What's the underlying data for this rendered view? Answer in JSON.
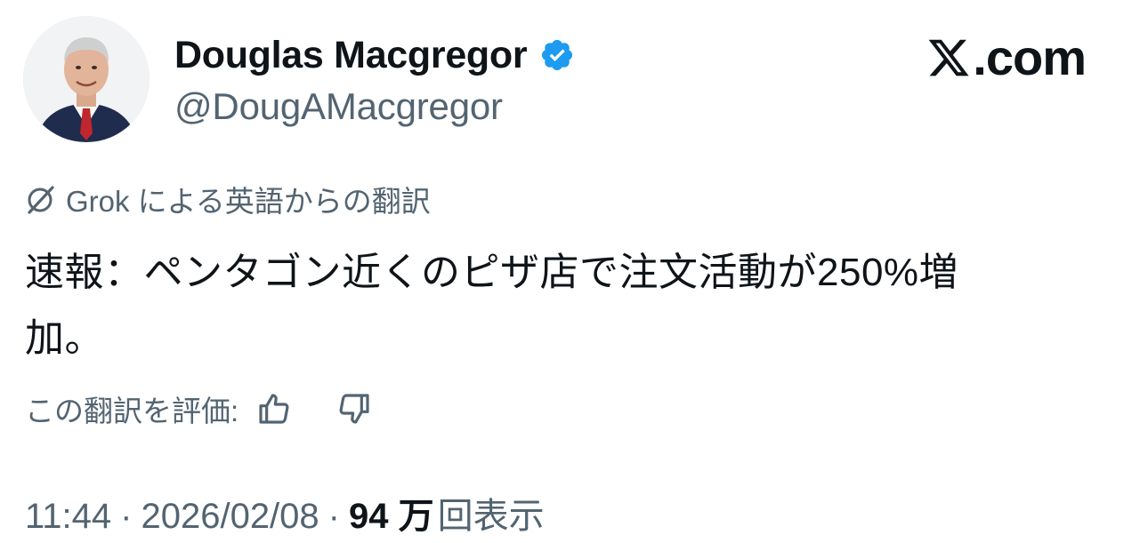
{
  "author": {
    "display_name": "Douglas Macgregor",
    "handle": "@DougAMacgregor",
    "verified": true,
    "verified_color": "#1d9bf0"
  },
  "brand": {
    "text": ".com",
    "icon": "x-logo-icon"
  },
  "translation": {
    "notice": "Grok による英語からの翻訳",
    "icon": "grok-icon"
  },
  "tweet": {
    "text_line1": "速報：ペンタゴン近くのピザ店で注文活動が250%増",
    "text_line2": "加。"
  },
  "rate": {
    "label": "この翻訳を評価:",
    "up_icon": "thumbs-up-icon",
    "down_icon": "thumbs-down-icon"
  },
  "meta": {
    "time": "11:44",
    "separator": "·",
    "date": "2026/02/08",
    "views_count": "94 万",
    "views_label": "回表示"
  },
  "colors": {
    "text_primary": "#0f1419",
    "text_secondary": "#536471"
  }
}
